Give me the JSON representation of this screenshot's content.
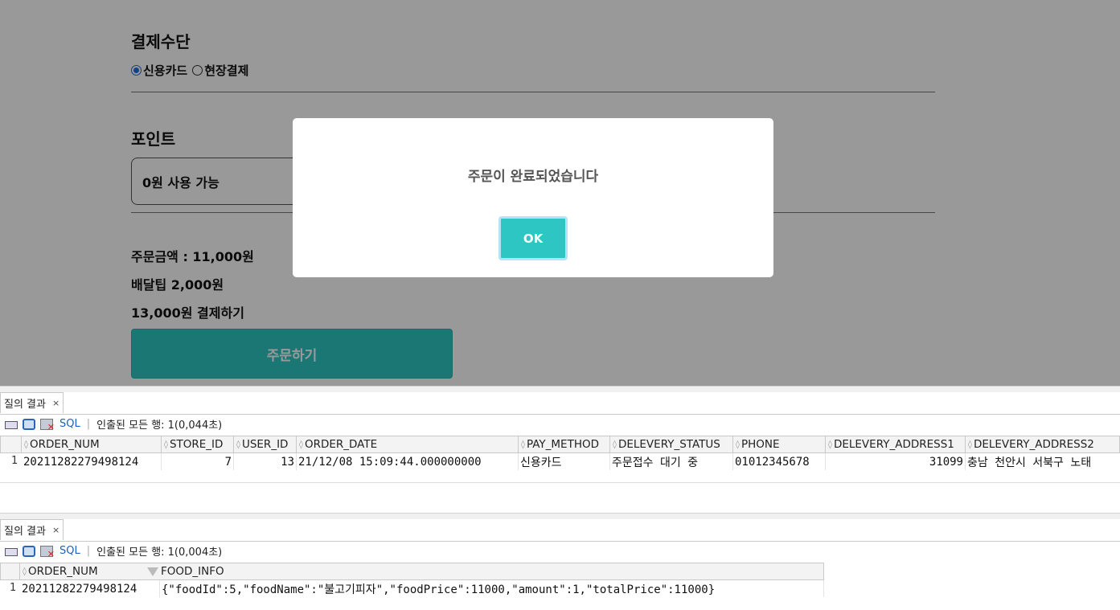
{
  "web": {
    "payment_title": "결제수단",
    "payment_options": [
      {
        "label": "신용카드",
        "selected": true
      },
      {
        "label": "현장결제",
        "selected": false
      }
    ],
    "point_title": "포인트",
    "point_available": "0원 사용 가능",
    "order_amount": "주문금액 : 11,000원",
    "delivery_tip": "배달팁 2,000원",
    "pay_total": "13,000원 결제하기",
    "order_button": "주문하기"
  },
  "dialog": {
    "message": "주문이 완료되었습니다",
    "ok_label": "OK"
  },
  "panel1": {
    "tab_label": "질의 결과",
    "toolbar_sql": "SQL",
    "fetch_status": "인출된 모든 행: 1(0,044초)",
    "columns": [
      "ORDER_NUM",
      "STORE_ID",
      "USER_ID",
      "ORDER_DATE",
      "PAY_METHOD",
      "DELEVERY_STATUS",
      "PHONE",
      "DELEVERY_ADDRESS1",
      "DELEVERY_ADDRESS2"
    ],
    "row_number": "1",
    "row": [
      "20211282279498124",
      "7",
      "13",
      "21/12/08 15:09:44.000000000",
      "신용카드",
      "주문접수 대기 중",
      "01012345678",
      "31099",
      "충남 천안시 서북구 노태"
    ]
  },
  "panel2": {
    "tab_label": "질의 결과",
    "toolbar_sql": "SQL",
    "fetch_status": "인출된 모든 행: 1(0,004초)",
    "columns": [
      "ORDER_NUM",
      "FOOD_INFO"
    ],
    "row_number": "1",
    "row": [
      "20211282279498124",
      "{\"foodId\":5,\"foodName\":\"불고기피자\",\"foodPrice\":11000,\"amount\":1,\"totalPrice\":11000}"
    ]
  },
  "colors": {
    "teal": "#2dc6c2",
    "overlay": "rgba(0,0,0,0.40)",
    "sql_link": "#1f5fbf"
  }
}
